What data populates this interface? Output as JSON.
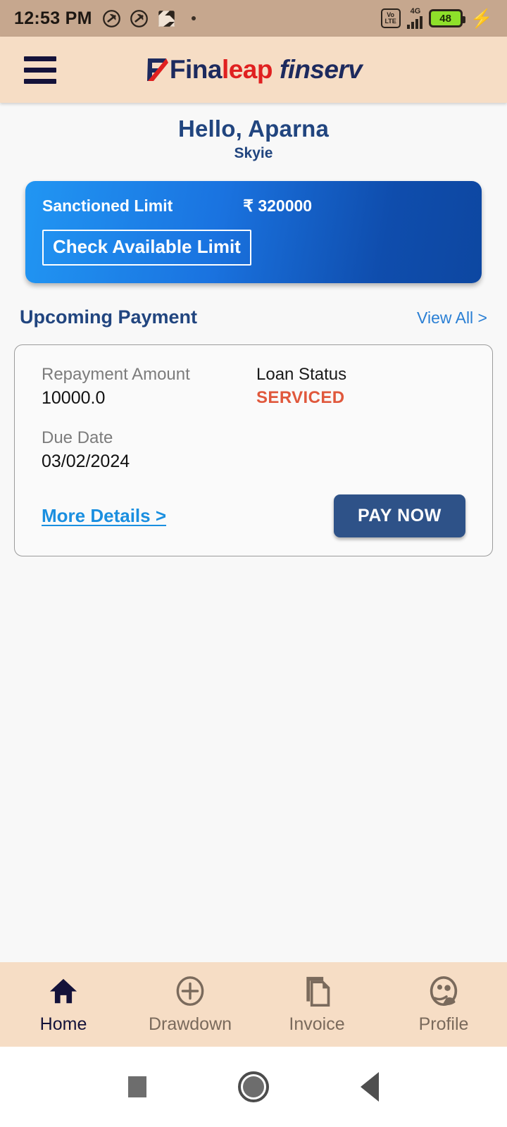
{
  "statusbar": {
    "time": "12:53 PM",
    "left_icons": [
      "do-not-disturb-icon",
      "do-not-disturb-icon",
      "image-icon"
    ],
    "network_label": "4G",
    "volte_top": "Vo",
    "volte_bottom": "LTE",
    "battery_percent": "48",
    "charging_icon": "⚡"
  },
  "appbar": {
    "menu_icon": "hamburger-icon",
    "logo_part1": "Fina",
    "logo_part2": "leap",
    "logo_part3": "finserv"
  },
  "greeting": {
    "title": "Hello, Aparna",
    "subtitle": "Skyie"
  },
  "limit_card": {
    "label": "Sanctioned Limit",
    "value": "₹ 320000",
    "button_label": "Check Available Limit"
  },
  "upcoming": {
    "section_title": "Upcoming Payment",
    "view_all": "View All >"
  },
  "payment_card": {
    "repayment_label": "Repayment Amount",
    "repayment_value": "10000.0",
    "status_label": "Loan Status",
    "status_value": "SERVICED",
    "due_date_label": "Due Date",
    "due_date_value": "03/02/2024",
    "more_details": "More Details >",
    "pay_now": "PAY NOW"
  },
  "bottom_nav": [
    {
      "label": "Home",
      "icon": "home-icon",
      "active": true
    },
    {
      "label": "Drawdown",
      "icon": "plus-circle-icon",
      "active": false
    },
    {
      "label": "Invoice",
      "icon": "documents-icon",
      "active": false
    },
    {
      "label": "Profile",
      "icon": "profile-face-icon",
      "active": false
    }
  ],
  "system_nav": {
    "recents": "square-icon",
    "home": "circle-icon",
    "back": "triangle-back-icon"
  },
  "colors": {
    "header_bg": "#f6ddc5",
    "statusbar_bg": "#c6a78e",
    "navy": "#21457f",
    "accent_blue": "#2a7fd4",
    "card_gradient_start": "#2196f3",
    "card_gradient_end": "#0d47a1",
    "status_orange": "#e0583c",
    "pay_button": "#2e5288",
    "logo_red": "#e02020"
  }
}
